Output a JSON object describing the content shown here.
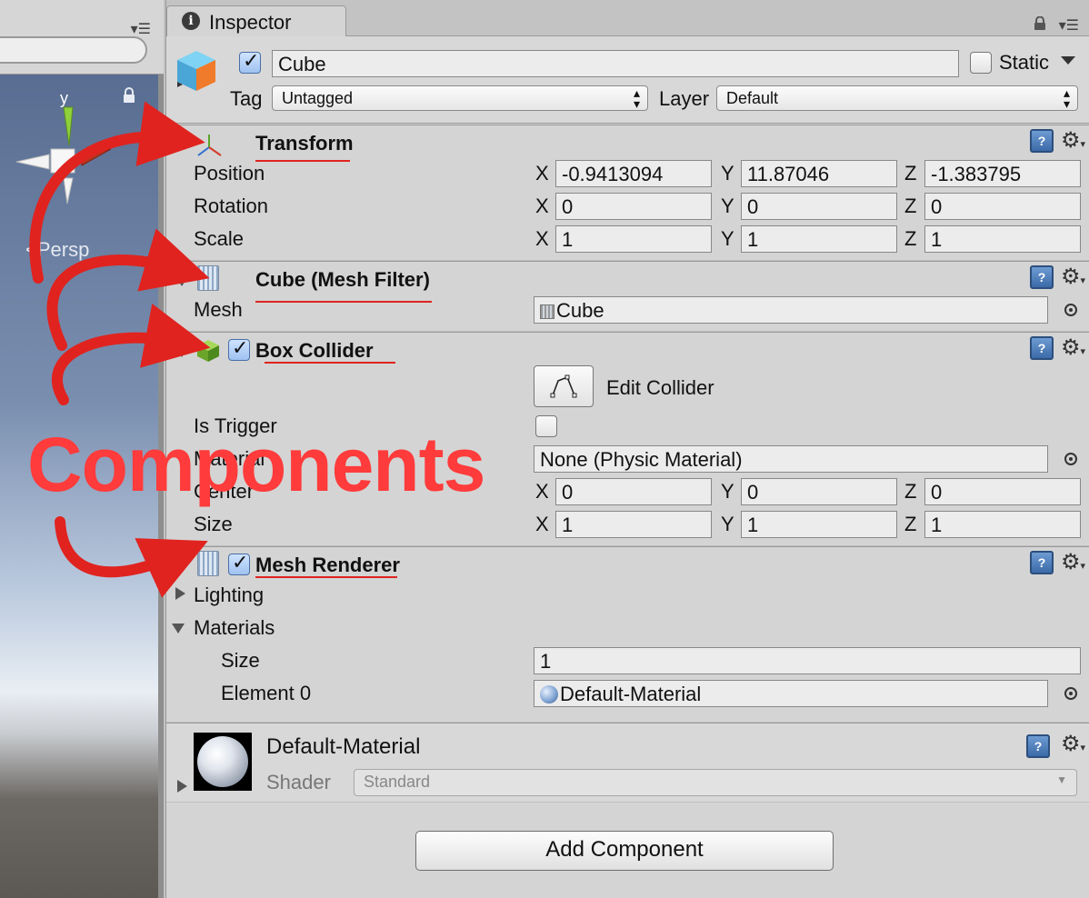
{
  "scene": {
    "persp_label": "<Persp",
    "gizmo_axis_label": "y"
  },
  "inspector": {
    "tab_label": "Inspector",
    "object": {
      "name": "Cube",
      "active": true,
      "static_label": "Static",
      "static": false,
      "tag_label": "Tag",
      "tag_value": "Untagged",
      "layer_label": "Layer",
      "layer_value": "Default"
    },
    "transform": {
      "title": "Transform",
      "rows": [
        {
          "label": "Position",
          "x": "-0.9413094",
          "y": "11.87046",
          "z": "-1.383795"
        },
        {
          "label": "Rotation",
          "x": "0",
          "y": "0",
          "z": "0"
        },
        {
          "label": "Scale",
          "x": "1",
          "y": "1",
          "z": "1"
        }
      ]
    },
    "mesh_filter": {
      "title": "Cube (Mesh Filter)",
      "mesh_label": "Mesh",
      "mesh_value": "Cube"
    },
    "box_collider": {
      "title": "Box Collider",
      "enabled": true,
      "edit_label": "Edit Collider",
      "is_trigger_label": "Is Trigger",
      "is_trigger": false,
      "material_label": "Material",
      "material_value": "None (Physic Material)",
      "center": {
        "label": "Center",
        "x": "0",
        "y": "0",
        "z": "0"
      },
      "size": {
        "label": "Size",
        "x": "1",
        "y": "1",
        "z": "1"
      }
    },
    "mesh_renderer": {
      "title": "Mesh Renderer",
      "enabled": true,
      "lighting_label": "Lighting",
      "materials_label": "Materials",
      "size_label": "Size",
      "size_value": "1",
      "element_label": "Element 0",
      "element_value": "Default-Material"
    },
    "material": {
      "name": "Default-Material",
      "shader_label": "Shader",
      "shader_value": "Standard"
    },
    "add_component_label": "Add Component",
    "axis_labels": {
      "x": "X",
      "y": "Y",
      "z": "Z"
    }
  },
  "annotation": {
    "text": "Components",
    "color": "#ff3b3b"
  },
  "colors": {
    "panel": "#d4d4d4",
    "annotation_red": "#e0231f"
  }
}
